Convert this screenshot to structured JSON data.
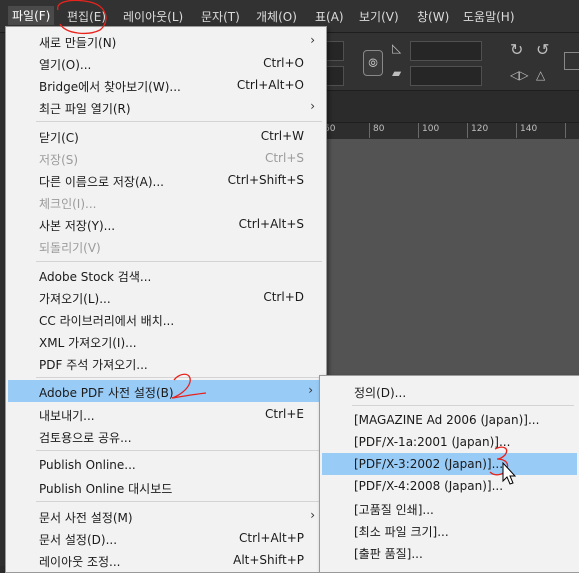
{
  "menubar": {
    "items": [
      "파일(F)",
      "편집(E)",
      "레이아웃(L)",
      "문자(T)",
      "개체(O)",
      "표(A)",
      "보기(V)",
      "창(W)",
      "도움말(H)"
    ]
  },
  "ruler": {
    "labels": [
      "60",
      "80",
      "100",
      "120",
      "140"
    ]
  },
  "file_menu": {
    "items": [
      {
        "label": "새로 만들기(N)",
        "shortcut": "",
        "submenu": true
      },
      {
        "label": "열기(O)...",
        "shortcut": "Ctrl+O"
      },
      {
        "label": "Bridge에서 찾아보기(W)...",
        "shortcut": "Ctrl+Alt+O"
      },
      {
        "label": "최근 파일 열기(R)",
        "shortcut": "",
        "submenu": true
      },
      {
        "label": "닫기(C)",
        "shortcut": "Ctrl+W"
      },
      {
        "label": "저장(S)",
        "shortcut": "Ctrl+S",
        "disabled": true
      },
      {
        "label": "다른 이름으로 저장(A)...",
        "shortcut": "Ctrl+Shift+S"
      },
      {
        "label": "체크인(I)...",
        "shortcut": "",
        "disabled": true
      },
      {
        "label": "사본 저장(Y)...",
        "shortcut": "Ctrl+Alt+S"
      },
      {
        "label": "되돌리기(V)",
        "shortcut": "",
        "disabled": true
      },
      {
        "label": "Adobe Stock 검색...",
        "shortcut": ""
      },
      {
        "label": "가져오기(L)...",
        "shortcut": "Ctrl+D"
      },
      {
        "label": "CC 라이브러리에서 배치...",
        "shortcut": ""
      },
      {
        "label": "XML 가져오기(I)...",
        "shortcut": ""
      },
      {
        "label": "PDF 주석 가져오기...",
        "shortcut": ""
      },
      {
        "label": "Adobe PDF 사전 설정(B)",
        "shortcut": "",
        "submenu": true,
        "highlighted": true
      },
      {
        "label": "내보내기...",
        "shortcut": "Ctrl+E"
      },
      {
        "label": "검토용으로 공유...",
        "shortcut": ""
      },
      {
        "label": "Publish Online...",
        "shortcut": ""
      },
      {
        "label": "Publish Online 대시보드",
        "shortcut": ""
      },
      {
        "label": "문서 사전 설정(M)",
        "shortcut": "",
        "submenu": true
      },
      {
        "label": "문서 설정(D)...",
        "shortcut": "Ctrl+Alt+P"
      },
      {
        "label": "레이아웃 조정...",
        "shortcut": "Alt+Shift+P"
      }
    ]
  },
  "pdf_submenu": {
    "items": [
      {
        "label": "정의(D)..."
      },
      {
        "label": "[MAGAZINE Ad 2006 (Japan)]..."
      },
      {
        "label": "[PDF/X-1a:2001 (Japan)]..."
      },
      {
        "label": "[PDF/X-3:2002 (Japan)]...",
        "highlighted": true
      },
      {
        "label": "[PDF/X-4:2008 (Japan)]..."
      },
      {
        "label": "[고품질 인쇄]..."
      },
      {
        "label": "[최소 파일 크기]..."
      },
      {
        "label": "[출판 품질]..."
      }
    ]
  },
  "colors": {
    "menu_bg": "#f2f2f2",
    "highlight": "#99cbf7",
    "annotation": "#e8231c",
    "app_bg": "#323232"
  }
}
